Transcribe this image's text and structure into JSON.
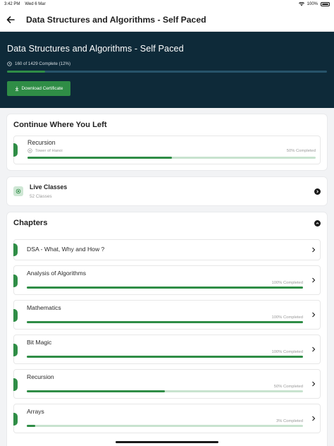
{
  "status_bar": {
    "time": "3:42 PM",
    "date": "Wed 6 Mar",
    "battery": "100%"
  },
  "header": {
    "title": "Data Structures and Algorithms - Self Paced"
  },
  "hero": {
    "title": "Data Structures and Algorithms - Self Paced",
    "progress_text": "160 of 1429 Complete (12%)",
    "progress_fraction": 0.12,
    "download_label": "Download Certificate"
  },
  "continue": {
    "title": "Continue Where You Left",
    "item": {
      "name": "Recursion",
      "subtopic": "Tower of Hanoi",
      "status": "50% Completed",
      "progress_fraction": 0.5
    }
  },
  "live": {
    "title": "Live Classes",
    "subtitle": "52 Classes"
  },
  "chapters": {
    "title": "Chapters",
    "items": [
      {
        "name": "DSA - What, Why and How ?",
        "status": "",
        "progress_fraction": null
      },
      {
        "name": "Analysis of Algorithms",
        "status": "100% Completed",
        "progress_fraction": 1.0
      },
      {
        "name": "Mathematics",
        "status": "100% Completed",
        "progress_fraction": 1.0
      },
      {
        "name": "Bit Magic",
        "status": "100% Completed",
        "progress_fraction": 1.0
      },
      {
        "name": "Recursion",
        "status": "50% Completed",
        "progress_fraction": 0.5
      },
      {
        "name": "Arrays",
        "status": "3% Completed",
        "progress_fraction": 0.03
      }
    ]
  },
  "colors": {
    "accent_green": "#2f8d46",
    "hero_bg": "#0e2a39",
    "track_light": "#c8e3cf"
  }
}
